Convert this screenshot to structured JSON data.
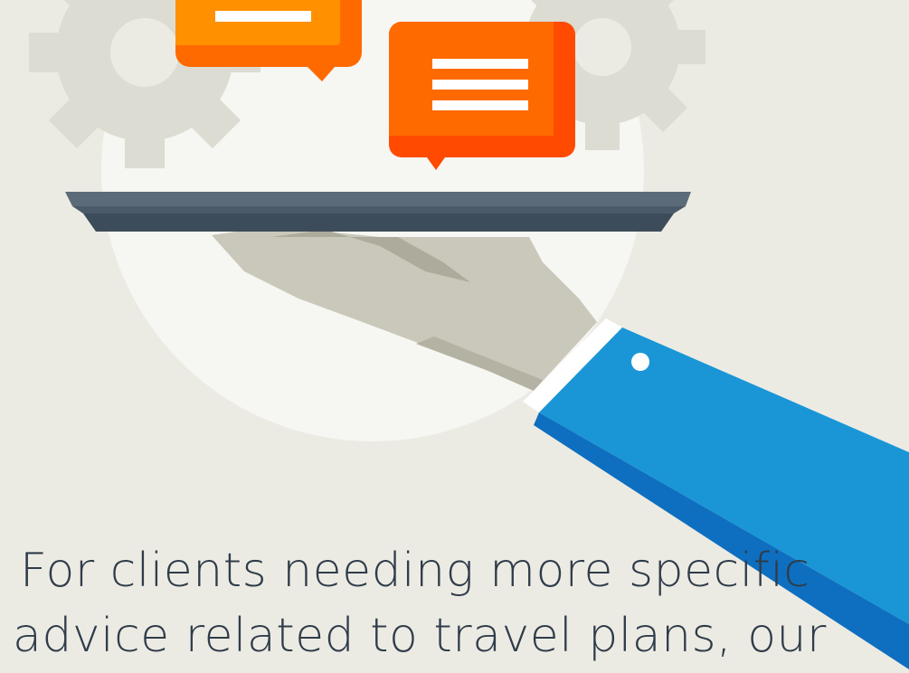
{
  "caption": {
    "line1": "For clients needing more specific",
    "line2": "advice related to travel plans, our"
  },
  "colors": {
    "background": "#ECEBE3",
    "circle": "#F6F6F2",
    "gear": "#DCDCD2",
    "bubble_orange": "#FF6A00",
    "bubble_amber": "#FF9000",
    "tray": "#4B5A68",
    "hand": "#C9C8BA",
    "sleeve": "#1A96D6",
    "text": "#2F3C4A"
  },
  "icons": [
    "gear-icon",
    "chat-bubble-icon",
    "serving-tray",
    "hand",
    "sleeve"
  ]
}
